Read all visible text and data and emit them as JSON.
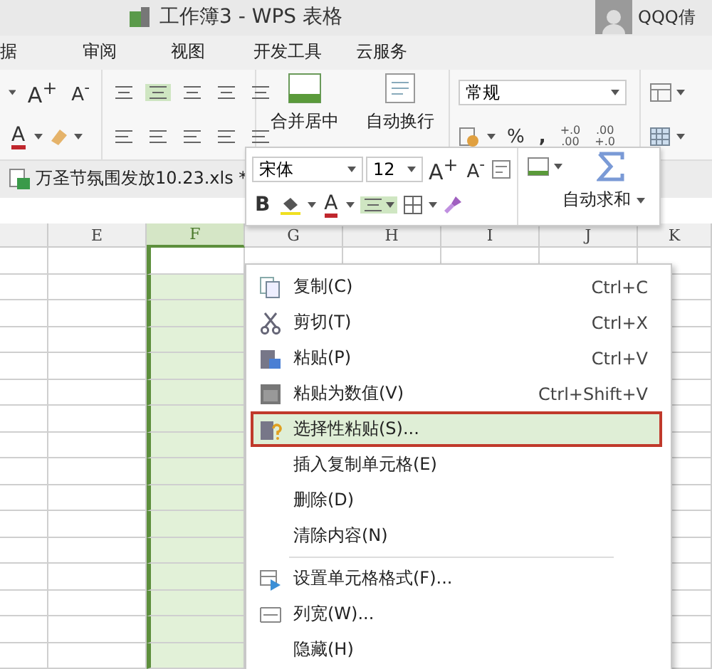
{
  "title_bar": {
    "title": "工作簿3 - WPS 表格",
    "user": "QQQ倩"
  },
  "menu_tabs": [
    "据",
    "审阅",
    "视图",
    "开发工具",
    "云服务"
  ],
  "ribbon": {
    "font_grow": "A$^{+}$",
    "font_shrink": "A$^{-}$",
    "font_color": "A",
    "merge_center": "合并居中",
    "wrap_text": "自动换行",
    "number_format": "常规",
    "percent": "%",
    "comma": ",",
    "increase_decimal": [
      "+.0",
      ".00"
    ],
    "decrease_decimal": [
      ".00",
      "+.0"
    ]
  },
  "file_tab": {
    "name": "万圣节氛围发放10.23.xls *"
  },
  "mini_toolbar": {
    "font": "宋体",
    "size": "12",
    "grow": "A$^{+}$",
    "shrink": "A$^{-}$",
    "bold": "B",
    "font_color": "A",
    "autosum": "自动求和"
  },
  "sheet": {
    "columns": [
      {
        "selected": false
      },
      {
        "label": "E",
        "selected": false
      },
      {
        "label": "F",
        "selected": true
      },
      {
        "label": "G",
        "selected": false
      },
      {
        "label": "H",
        "selected": false
      },
      {
        "label": "I",
        "selected": false
      },
      {
        "label": "J",
        "selected": false
      },
      {
        "label": "K",
        "selected": false
      }
    ]
  },
  "context_menu": {
    "items": [
      {
        "kind": "item",
        "label": "复制(C)",
        "shortcut": "Ctrl+C",
        "highlighted": false
      },
      {
        "kind": "item",
        "label": "剪切(T)",
        "shortcut": "Ctrl+X",
        "highlighted": false
      },
      {
        "kind": "item",
        "label": "粘贴(P)",
        "shortcut": "Ctrl+V",
        "highlighted": false
      },
      {
        "kind": "item",
        "label": "粘贴为数值(V)",
        "shortcut": "Ctrl+Shift+V",
        "highlighted": false
      },
      {
        "kind": "item",
        "label": "选择性粘贴(S)...",
        "highlighted": true
      },
      {
        "kind": "item",
        "label": "插入复制单元格(E)",
        "highlighted": false
      },
      {
        "kind": "item",
        "label": "删除(D)",
        "highlighted": false
      },
      {
        "kind": "item",
        "label": "清除内容(N)",
        "highlighted": false
      },
      {
        "kind": "separator"
      },
      {
        "kind": "item",
        "label": "设置单元格格式(F)...",
        "highlighted": false
      },
      {
        "kind": "item",
        "label": "列宽(W)...",
        "highlighted": false
      },
      {
        "kind": "item",
        "label": "隐藏(H)",
        "highlighted": false
      }
    ]
  }
}
